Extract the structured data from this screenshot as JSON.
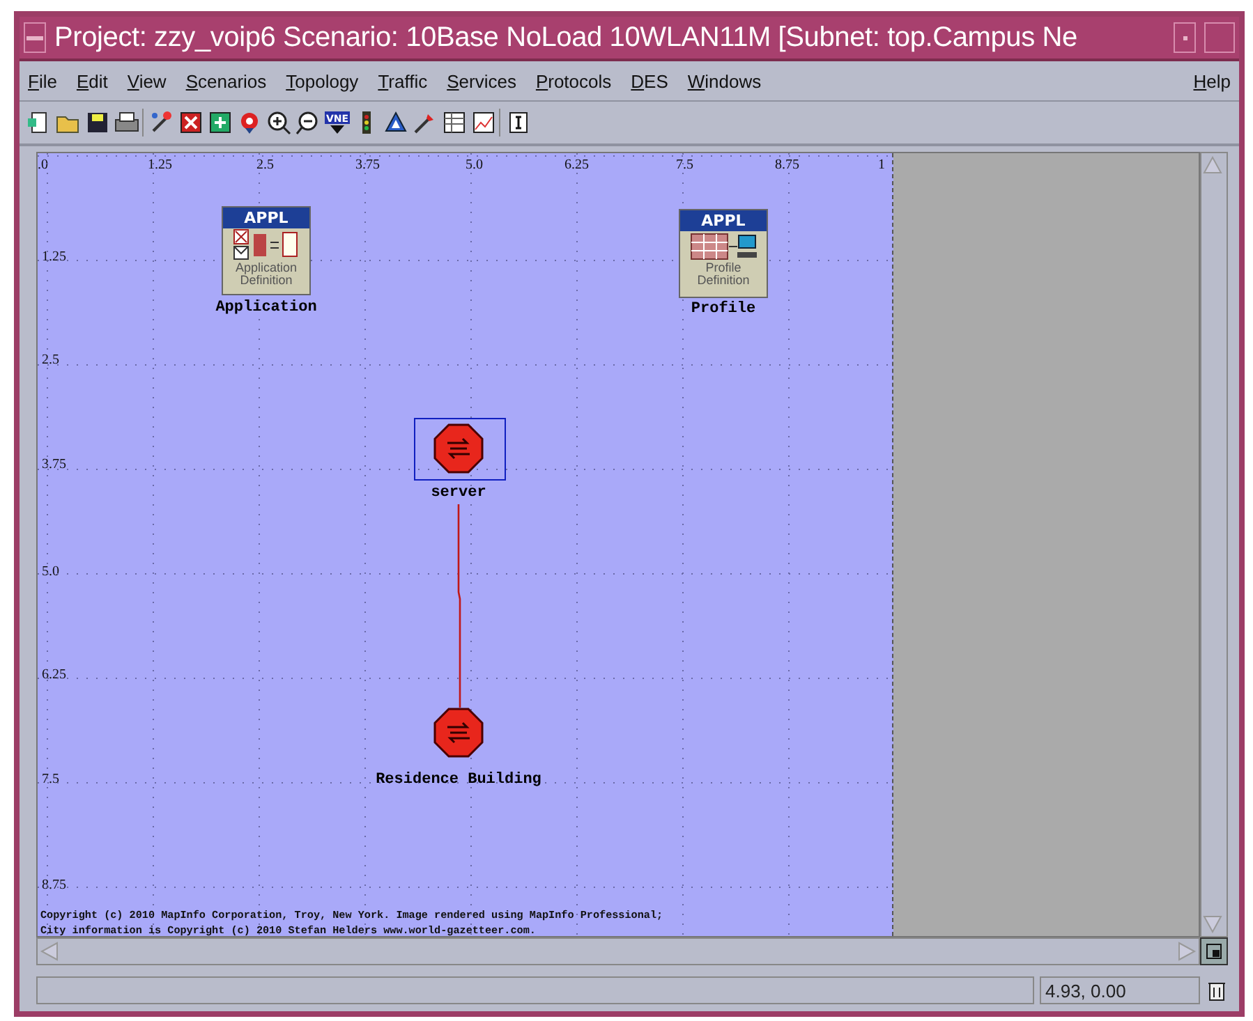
{
  "window": {
    "title": "Project: zzy_voip6 Scenario: 10Base NoLoad 10WLAN11M  [Subnet: top.Campus Ne"
  },
  "menu": [
    {
      "label": "File"
    },
    {
      "label": "Edit"
    },
    {
      "label": "View"
    },
    {
      "label": "Scenarios"
    },
    {
      "label": "Topology"
    },
    {
      "label": "Traffic"
    },
    {
      "label": "Services"
    },
    {
      "label": "Protocols"
    },
    {
      "label": "DES"
    },
    {
      "label": "Windows"
    }
  ],
  "help_menu": {
    "label": "Help"
  },
  "toolbar": {
    "vne_label": "VNE"
  },
  "canvas": {
    "x_ruler": [
      ".0",
      "1.25",
      "2.5",
      "3.75",
      "5.0",
      "6.25",
      "7.5",
      "8.75",
      "1"
    ],
    "y_ruler": [
      "1.25",
      "2.5",
      "3.75",
      "5.0",
      "6.25",
      "7.5",
      "8.75"
    ],
    "nodes": [
      {
        "kind": "config",
        "badge": "APPL",
        "caption": "Application Definition",
        "label": "Application",
        "selected": false
      },
      {
        "kind": "profile",
        "badge": "APPL",
        "caption": "Profile Definition",
        "label": "Profile",
        "selected": false
      },
      {
        "kind": "router",
        "label": "server",
        "selected": true,
        "linked_to_next": true
      },
      {
        "kind": "router",
        "label": "Residence Building",
        "selected": false
      }
    ],
    "copyright": [
      "Copyright (c) 2010 MapInfo Corporation, Troy, New York. Image rendered using MapInfo Professional;",
      "City information is Copyright (c) 2010 Stefan Helders www.world-gazetteer.com."
    ]
  },
  "status_bar": {
    "coordinates": "4.93, 0.00"
  }
}
